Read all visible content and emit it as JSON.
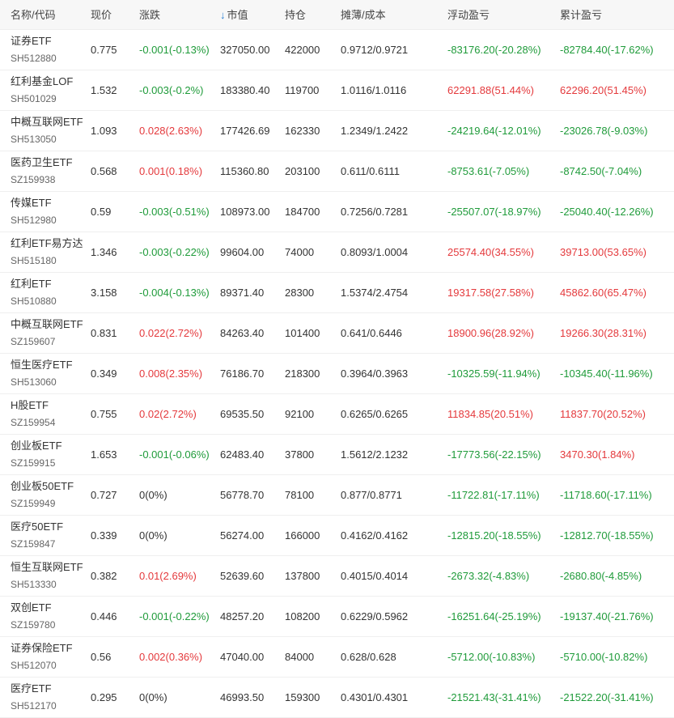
{
  "headers": {
    "name_code": "名称/代码",
    "price": "现价",
    "change": "涨跌",
    "market_value": "市值",
    "position": "持仓",
    "cost": "摊薄/成本",
    "floating_pl": "浮动盈亏",
    "cumulative_pl": "累计盈亏"
  },
  "sort": {
    "column": "market_value",
    "direction": "desc",
    "icon": "arrow-down-icon"
  },
  "colors": {
    "up": "#e4393c",
    "down": "#1f9b3a",
    "neutral": "#333333",
    "header_bg": "#f7f7f7",
    "sort_icon": "#2a7fd4"
  },
  "rows": [
    {
      "name": "证券ETF",
      "code": "SH512880",
      "price": "0.775",
      "change": "-0.001(-0.13%)",
      "change_dir": "down",
      "market_value": "327050.00",
      "position": "422000",
      "cost": "0.9712/0.9721",
      "floating_pl": "-83176.20(-20.28%)",
      "floating_dir": "down",
      "cumulative_pl": "-82784.40(-17.62%)",
      "cumulative_dir": "down"
    },
    {
      "name": "红利基金LOF",
      "code": "SH501029",
      "price": "1.532",
      "change": "-0.003(-0.2%)",
      "change_dir": "down",
      "market_value": "183380.40",
      "position": "119700",
      "cost": "1.0116/1.0116",
      "floating_pl": "62291.88(51.44%)",
      "floating_dir": "up",
      "cumulative_pl": "62296.20(51.45%)",
      "cumulative_dir": "up"
    },
    {
      "name": "中概互联网ETF",
      "code": "SH513050",
      "price": "1.093",
      "change": "0.028(2.63%)",
      "change_dir": "up",
      "market_value": "177426.69",
      "position": "162330",
      "cost": "1.2349/1.2422",
      "floating_pl": "-24219.64(-12.01%)",
      "floating_dir": "down",
      "cumulative_pl": "-23026.78(-9.03%)",
      "cumulative_dir": "down"
    },
    {
      "name": "医药卫生ETF",
      "code": "SZ159938",
      "price": "0.568",
      "change": "0.001(0.18%)",
      "change_dir": "up",
      "market_value": "115360.80",
      "position": "203100",
      "cost": "0.611/0.6111",
      "floating_pl": "-8753.61(-7.05%)",
      "floating_dir": "down",
      "cumulative_pl": "-8742.50(-7.04%)",
      "cumulative_dir": "down"
    },
    {
      "name": "传媒ETF",
      "code": "SH512980",
      "price": "0.59",
      "change": "-0.003(-0.51%)",
      "change_dir": "down",
      "market_value": "108973.00",
      "position": "184700",
      "cost": "0.7256/0.7281",
      "floating_pl": "-25507.07(-18.97%)",
      "floating_dir": "down",
      "cumulative_pl": "-25040.40(-12.26%)",
      "cumulative_dir": "down"
    },
    {
      "name": "红利ETF易方达",
      "code": "SH515180",
      "price": "1.346",
      "change": "-0.003(-0.22%)",
      "change_dir": "down",
      "market_value": "99604.00",
      "position": "74000",
      "cost": "0.8093/1.0004",
      "floating_pl": "25574.40(34.55%)",
      "floating_dir": "up",
      "cumulative_pl": "39713.00(53.65%)",
      "cumulative_dir": "up"
    },
    {
      "name": "红利ETF",
      "code": "SH510880",
      "price": "3.158",
      "change": "-0.004(-0.13%)",
      "change_dir": "down",
      "market_value": "89371.40",
      "position": "28300",
      "cost": "1.5374/2.4754",
      "floating_pl": "19317.58(27.58%)",
      "floating_dir": "up",
      "cumulative_pl": "45862.60(65.47%)",
      "cumulative_dir": "up"
    },
    {
      "name": "中概互联网ETF",
      "code": "SZ159607",
      "price": "0.831",
      "change": "0.022(2.72%)",
      "change_dir": "up",
      "market_value": "84263.40",
      "position": "101400",
      "cost": "0.641/0.6446",
      "floating_pl": "18900.96(28.92%)",
      "floating_dir": "up",
      "cumulative_pl": "19266.30(28.31%)",
      "cumulative_dir": "up"
    },
    {
      "name": "恒生医疗ETF",
      "code": "SH513060",
      "price": "0.349",
      "change": "0.008(2.35%)",
      "change_dir": "up",
      "market_value": "76186.70",
      "position": "218300",
      "cost": "0.3964/0.3963",
      "floating_pl": "-10325.59(-11.94%)",
      "floating_dir": "down",
      "cumulative_pl": "-10345.40(-11.96%)",
      "cumulative_dir": "down"
    },
    {
      "name": "H股ETF",
      "code": "SZ159954",
      "price": "0.755",
      "change": "0.02(2.72%)",
      "change_dir": "up",
      "market_value": "69535.50",
      "position": "92100",
      "cost": "0.6265/0.6265",
      "floating_pl": "11834.85(20.51%)",
      "floating_dir": "up",
      "cumulative_pl": "11837.70(20.52%)",
      "cumulative_dir": "up"
    },
    {
      "name": "创业板ETF",
      "code": "SZ159915",
      "price": "1.653",
      "change": "-0.001(-0.06%)",
      "change_dir": "down",
      "market_value": "62483.40",
      "position": "37800",
      "cost": "1.5612/2.1232",
      "floating_pl": "-17773.56(-22.15%)",
      "floating_dir": "down",
      "cumulative_pl": "3470.30(1.84%)",
      "cumulative_dir": "up"
    },
    {
      "name": "创业板50ETF",
      "code": "SZ159949",
      "price": "0.727",
      "change": "0(0%)",
      "change_dir": "flat",
      "market_value": "56778.70",
      "position": "78100",
      "cost": "0.877/0.8771",
      "floating_pl": "-11722.81(-17.11%)",
      "floating_dir": "down",
      "cumulative_pl": "-11718.60(-17.11%)",
      "cumulative_dir": "down"
    },
    {
      "name": "医疗50ETF",
      "code": "SZ159847",
      "price": "0.339",
      "change": "0(0%)",
      "change_dir": "flat",
      "market_value": "56274.00",
      "position": "166000",
      "cost": "0.4162/0.4162",
      "floating_pl": "-12815.20(-18.55%)",
      "floating_dir": "down",
      "cumulative_pl": "-12812.70(-18.55%)",
      "cumulative_dir": "down"
    },
    {
      "name": "恒生互联网ETF",
      "code": "SH513330",
      "price": "0.382",
      "change": "0.01(2.69%)",
      "change_dir": "up",
      "market_value": "52639.60",
      "position": "137800",
      "cost": "0.4015/0.4014",
      "floating_pl": "-2673.32(-4.83%)",
      "floating_dir": "down",
      "cumulative_pl": "-2680.80(-4.85%)",
      "cumulative_dir": "down"
    },
    {
      "name": "双创ETF",
      "code": "SZ159780",
      "price": "0.446",
      "change": "-0.001(-0.22%)",
      "change_dir": "down",
      "market_value": "48257.20",
      "position": "108200",
      "cost": "0.6229/0.5962",
      "floating_pl": "-16251.64(-25.19%)",
      "floating_dir": "down",
      "cumulative_pl": "-19137.40(-21.76%)",
      "cumulative_dir": "down"
    },
    {
      "name": "证券保险ETF",
      "code": "SH512070",
      "price": "0.56",
      "change": "0.002(0.36%)",
      "change_dir": "up",
      "market_value": "47040.00",
      "position": "84000",
      "cost": "0.628/0.628",
      "floating_pl": "-5712.00(-10.83%)",
      "floating_dir": "down",
      "cumulative_pl": "-5710.00(-10.82%)",
      "cumulative_dir": "down"
    },
    {
      "name": "医疗ETF",
      "code": "SH512170",
      "price": "0.295",
      "change": "0(0%)",
      "change_dir": "flat",
      "market_value": "46993.50",
      "position": "159300",
      "cost": "0.4301/0.4301",
      "floating_pl": "-21521.43(-31.41%)",
      "floating_dir": "down",
      "cumulative_pl": "-21522.20(-31.41%)",
      "cumulative_dir": "down"
    }
  ]
}
